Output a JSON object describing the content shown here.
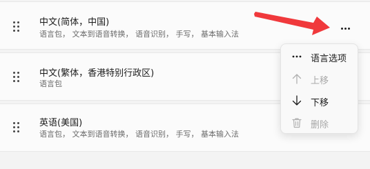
{
  "languages": [
    {
      "name": "中文(简体，中国)",
      "features": "语言包， 文本到语音转换， 语音识别， 手写， 基本输入法"
    },
    {
      "name": "中文(繁体，香港特别行政区)",
      "features": "语言包"
    },
    {
      "name": "英语(美国)",
      "features": "语言包， 文本到语音转换， 语音识别， 手写， 基本输入法"
    }
  ],
  "context_menu": {
    "items": [
      {
        "label": "语言选项",
        "icon": "more-icon",
        "enabled": true
      },
      {
        "label": "上移",
        "icon": "arrow-up-icon",
        "enabled": false
      },
      {
        "label": "下移",
        "icon": "arrow-down-icon",
        "enabled": true
      },
      {
        "label": "删除",
        "icon": "trash-icon",
        "enabled": false
      }
    ]
  },
  "colors": {
    "annotation_arrow": "#f0393c",
    "card_background": "#fbfbfb",
    "page_background": "#f3f3f3"
  }
}
